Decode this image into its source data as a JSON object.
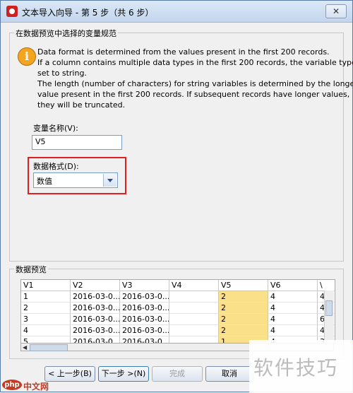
{
  "window": {
    "title": "文本导入向导 - 第 5 步（共 6 步）",
    "close_label": "✕"
  },
  "spec_group": {
    "legend": "在数据预览中选择的变量规范",
    "info_icon": "i",
    "info_lines": [
      "Data format is determined from the values present in the first 200 records.",
      "If a column contains multiple data types in the first 200 records, the variable type is",
      "set to string.",
      "The length (number of characters) for string variables is determined by the longest",
      "value present in the first 200 records. If subsequent records have longer values,",
      "they will be truncated."
    ],
    "var_name_label": "变量名称(V):",
    "var_name_value": "V5",
    "format_label": "数据格式(D):",
    "format_value": "数值",
    "highlight_color": "#e02020"
  },
  "preview": {
    "legend": "数据预览",
    "headers": [
      "V1",
      "V2",
      "V3",
      "V4",
      "V5",
      "V6",
      "\\"
    ],
    "rows": [
      [
        "1",
        "2016-03-0...",
        "2016-03-0...",
        "",
        "2",
        "4",
        "4"
      ],
      [
        "2",
        "2016-03-0...",
        "2016-03-0...",
        "",
        "2",
        "4",
        "4"
      ],
      [
        "3",
        "2016-03-0...",
        "2016-03-0...",
        "",
        "2",
        "4",
        "6"
      ],
      [
        "4",
        "2016-03-0...",
        "2016-03-0...",
        "",
        "2",
        "4",
        "4"
      ],
      [
        "5",
        "2016-03-0...",
        "2016-03-0...",
        "",
        "1",
        "4",
        "3"
      ]
    ],
    "selected_column": "V5",
    "selected_color": "#fbe08a"
  },
  "buttons": {
    "back": "< 上一步(B)",
    "next": "下一步 >(N)",
    "finish": "完成",
    "cancel": "取消"
  },
  "watermark": {
    "text": "软件技巧",
    "logo": "php",
    "site": "中文网"
  }
}
